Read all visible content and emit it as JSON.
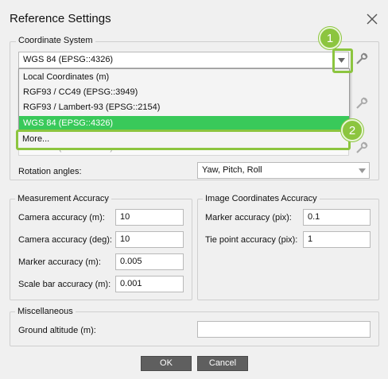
{
  "window": {
    "title": "Reference Settings",
    "close_icon": "close-icon"
  },
  "coordinate_system": {
    "label": "Coordinate System",
    "selected": "WGS 84 (EPSG::4326)",
    "obscured_field_partial": "WGS 84 (EPSG::4326)",
    "options": [
      "Local Coordinates (m)",
      "RGF93 / CC49 (EPSG::3949)",
      "RGF93 / Lambert-93 (EPSG::2154)",
      "WGS 84 (EPSG::4326)"
    ],
    "more_label": "More...",
    "rotation_label": "Rotation angles:",
    "rotation_value": "Yaw, Pitch, Roll"
  },
  "callouts": {
    "one": "1",
    "two": "2",
    "color": "#8cc53f"
  },
  "measurement_accuracy": {
    "label": "Measurement Accuracy",
    "fields": [
      {
        "label": "Camera accuracy (m):",
        "value": "10"
      },
      {
        "label": "Camera accuracy (deg):",
        "value": "10"
      },
      {
        "label": "Marker accuracy (m):",
        "value": "0.005"
      },
      {
        "label": "Scale bar accuracy (m):",
        "value": "0.001"
      }
    ]
  },
  "image_accuracy": {
    "label": "Image Coordinates Accuracy",
    "fields": [
      {
        "label": "Marker accuracy (pix):",
        "value": "0.1"
      },
      {
        "label": "Tie point accuracy (pix):",
        "value": "1"
      }
    ]
  },
  "miscellaneous": {
    "label": "Miscellaneous",
    "ground_altitude_label": "Ground altitude (m):",
    "ground_altitude_value": ""
  },
  "buttons": {
    "ok": "OK",
    "cancel": "Cancel"
  },
  "colors": {
    "selected_item": "#39c95a",
    "button_bg": "#5f5f5f"
  }
}
